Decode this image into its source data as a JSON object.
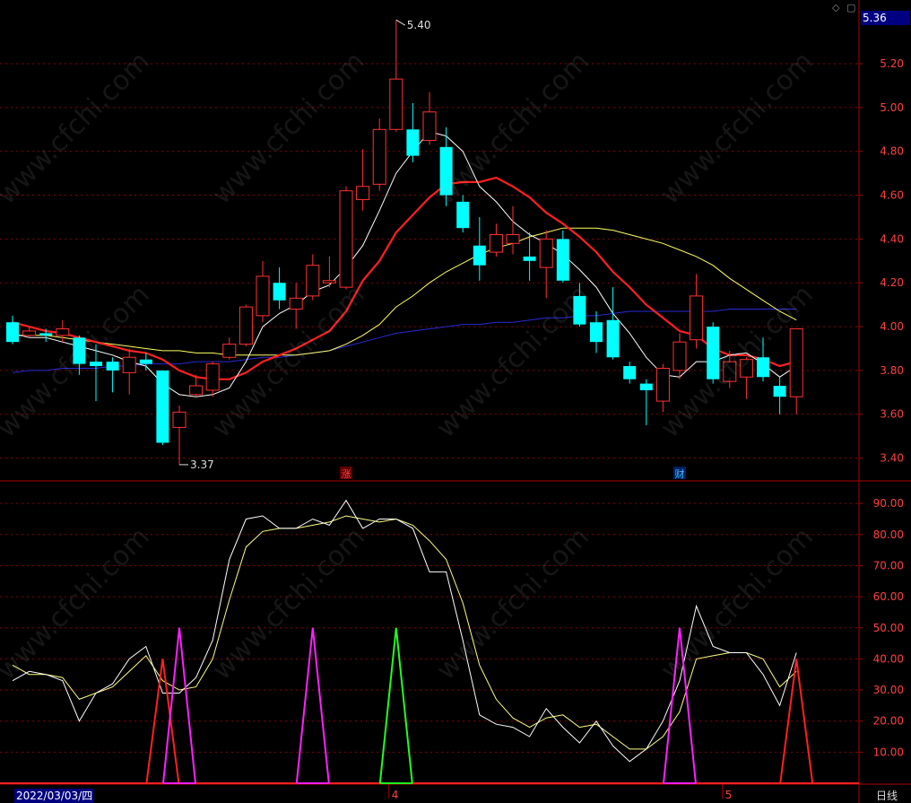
{
  "header": {
    "current_price": "5.36",
    "diamond_icon": "diamond-icon",
    "close_icon": "close-icon"
  },
  "footer": {
    "date": "2022/03/03/四",
    "period": "日线"
  },
  "watermark": "www.cfchi.com",
  "colors": {
    "up": "#ff3232",
    "down": "#00ffff",
    "ma5": "#ffffff",
    "ma10": "#ff2020",
    "ma20": "#ffff60",
    "ma60": "#2a2ad8",
    "grid": "#8b0000",
    "axis_text": "#ff4040"
  },
  "chart_data": [
    {
      "type": "candlestick",
      "ylim": [
        3.3,
        5.45
      ],
      "y_ticks": [
        "5.20",
        "5.00",
        "4.80",
        "4.60",
        "4.40",
        "4.20",
        "4.00",
        "3.80",
        "3.60",
        "3.40"
      ],
      "annotations": {
        "high": "5.40",
        "low": "3.37",
        "markers": [
          "涨",
          "财"
        ]
      },
      "candles": [
        [
          4.02,
          3.93,
          4.05,
          3.92
        ],
        [
          3.96,
          3.98,
          4.0,
          3.95
        ],
        [
          3.97,
          3.96,
          3.99,
          3.93
        ],
        [
          3.96,
          3.99,
          4.03,
          3.93
        ],
        [
          3.95,
          3.83,
          3.96,
          3.78
        ],
        [
          3.84,
          3.82,
          3.92,
          3.66
        ],
        [
          3.84,
          3.8,
          3.86,
          3.7
        ],
        [
          3.79,
          3.86,
          3.9,
          3.69
        ],
        [
          3.85,
          3.83,
          3.88,
          3.8
        ],
        [
          3.8,
          3.47,
          3.8,
          3.46
        ],
        [
          3.54,
          3.61,
          3.64,
          3.37
        ],
        [
          3.69,
          3.73,
          3.78,
          3.68
        ],
        [
          3.71,
          3.83,
          3.84,
          3.68
        ],
        [
          3.86,
          3.92,
          3.95,
          3.85
        ],
        [
          3.92,
          4.09,
          4.1,
          3.91
        ],
        [
          4.05,
          4.23,
          4.3,
          4.02
        ],
        [
          4.2,
          4.12,
          4.27,
          4.08
        ],
        [
          4.08,
          4.13,
          4.2,
          3.99
        ],
        [
          4.14,
          4.28,
          4.33,
          4.12
        ],
        [
          4.2,
          4.21,
          4.32,
          4.18
        ],
        [
          4.18,
          4.62,
          4.64,
          4.17
        ],
        [
          4.58,
          4.64,
          4.81,
          4.53
        ],
        [
          4.65,
          4.9,
          4.95,
          4.62
        ],
        [
          4.9,
          5.13,
          5.4,
          4.89
        ],
        [
          4.9,
          4.78,
          5.02,
          4.75
        ],
        [
          4.85,
          4.98,
          5.07,
          4.83
        ],
        [
          4.82,
          4.6,
          4.91,
          4.55
        ],
        [
          4.57,
          4.45,
          4.6,
          4.43
        ],
        [
          4.37,
          4.28,
          4.5,
          4.21
        ],
        [
          4.34,
          4.42,
          4.47,
          4.32
        ],
        [
          4.38,
          4.42,
          4.55,
          4.33
        ],
        [
          4.32,
          4.3,
          4.43,
          4.21
        ],
        [
          4.27,
          4.4,
          4.44,
          4.13
        ],
        [
          4.4,
          4.21,
          4.44,
          4.2
        ],
        [
          4.14,
          4.01,
          4.2,
          4.0
        ],
        [
          4.02,
          3.93,
          4.07,
          3.88
        ],
        [
          4.03,
          3.86,
          4.18,
          3.85
        ],
        [
          3.82,
          3.76,
          3.84,
          3.74
        ],
        [
          3.74,
          3.71,
          3.76,
          3.55
        ],
        [
          3.66,
          3.81,
          3.83,
          3.61
        ],
        [
          3.8,
          3.93,
          3.97,
          3.76
        ],
        [
          3.94,
          4.14,
          4.24,
          3.9
        ],
        [
          4.0,
          3.76,
          4.02,
          3.74
        ],
        [
          3.75,
          3.84,
          3.89,
          3.72
        ],
        [
          3.77,
          3.85,
          3.86,
          3.67
        ],
        [
          3.86,
          3.77,
          3.95,
          3.75
        ],
        [
          3.73,
          3.68,
          3.77,
          3.6
        ],
        [
          3.68,
          3.99,
          3.99,
          3.6
        ]
      ],
      "ma5": [
        3.97,
        3.95,
        3.95,
        3.93,
        3.91,
        3.89,
        3.87,
        3.84,
        3.82,
        3.74,
        3.69,
        3.68,
        3.69,
        3.72,
        3.84,
        4.0,
        4.06,
        4.1,
        4.16,
        4.19,
        4.27,
        4.37,
        4.53,
        4.7,
        4.8,
        4.89,
        4.87,
        4.8,
        4.64,
        4.57,
        4.48,
        4.42,
        4.38,
        4.33,
        4.26,
        4.18,
        4.06,
        3.97,
        3.86,
        3.78,
        3.77,
        3.84,
        3.84,
        3.87,
        3.88,
        3.83,
        3.77,
        3.82
      ],
      "ma10": [
        4.02,
        4.0,
        3.98,
        3.97,
        3.95,
        3.93,
        3.91,
        3.89,
        3.88,
        3.85,
        3.8,
        3.77,
        3.76,
        3.76,
        3.79,
        3.84,
        3.87,
        3.9,
        3.94,
        3.98,
        4.07,
        4.21,
        4.3,
        4.43,
        4.51,
        4.59,
        4.65,
        4.66,
        4.66,
        4.68,
        4.64,
        4.59,
        4.52,
        4.47,
        4.41,
        4.34,
        4.25,
        4.18,
        4.1,
        4.04,
        3.98,
        3.96,
        3.9,
        3.87,
        3.87,
        3.85,
        3.82,
        3.84
      ],
      "ma20": [
        3.96,
        3.96,
        3.96,
        3.95,
        3.94,
        3.93,
        3.92,
        3.91,
        3.9,
        3.89,
        3.89,
        3.88,
        3.88,
        3.87,
        3.87,
        3.87,
        3.87,
        3.87,
        3.88,
        3.89,
        3.92,
        3.96,
        4.01,
        4.09,
        4.14,
        4.2,
        4.25,
        4.29,
        4.33,
        4.36,
        4.38,
        4.41,
        4.43,
        4.45,
        4.45,
        4.45,
        4.44,
        4.42,
        4.4,
        4.38,
        4.35,
        4.32,
        4.28,
        4.22,
        4.17,
        4.12,
        4.07,
        4.03
      ],
      "ma60": [
        3.79,
        3.8,
        3.8,
        3.81,
        3.81,
        3.81,
        3.82,
        3.82,
        3.83,
        3.83,
        3.83,
        3.84,
        3.84,
        3.84,
        3.85,
        3.86,
        3.86,
        3.87,
        3.88,
        3.89,
        3.91,
        3.93,
        3.95,
        3.97,
        3.98,
        3.99,
        4.0,
        4.01,
        4.01,
        4.02,
        4.02,
        4.03,
        4.04,
        4.04,
        4.05,
        4.05,
        4.06,
        4.07,
        4.07,
        4.07,
        4.07,
        4.07,
        4.07,
        4.08,
        4.08,
        4.08,
        4.08,
        4.08
      ]
    },
    {
      "type": "line",
      "ylim": [
        0,
        100
      ],
      "y_ticks": [
        "90.00",
        "80.00",
        "70.00",
        "60.00",
        "50.00",
        "40.00",
        "30.00",
        "20.00",
        "10.00"
      ],
      "x_ticks": [
        {
          "label": "4",
          "index": 23
        },
        {
          "label": "5",
          "index": 43
        }
      ],
      "series": [
        {
          "values": [
            33,
            36,
            35,
            33,
            20,
            29,
            32,
            40,
            44,
            29,
            29,
            34,
            46,
            72,
            85,
            86,
            82,
            82,
            85,
            83,
            91,
            82,
            85,
            85,
            82,
            68,
            68,
            46,
            22,
            19,
            18,
            15,
            24,
            18,
            13,
            20,
            12,
            7,
            11,
            20,
            33,
            57,
            44,
            42,
            42,
            35,
            25,
            42
          ]
        },
        {
          "values": [
            38,
            35,
            35,
            34,
            27,
            29,
            31,
            36,
            41,
            33,
            30,
            31,
            40,
            59,
            76,
            81,
            82,
            82,
            83,
            84,
            86,
            85,
            84,
            85,
            83,
            78,
            72,
            58,
            38,
            27,
            21,
            18,
            21,
            22,
            18,
            19,
            15,
            11,
            11,
            15,
            23,
            40,
            41,
            42,
            42,
            40,
            31,
            36
          ]
        }
      ],
      "signals": [
        {
          "color": "#ff2020",
          "peak": 40,
          "index": 9
        },
        {
          "color": "#ff20ff",
          "peak": 50,
          "index": 10
        },
        {
          "color": "#ff20ff",
          "peak": 50,
          "index": 18
        },
        {
          "color": "#20ff20",
          "peak": 50,
          "index": 23
        },
        {
          "color": "#ff20ff",
          "peak": 50,
          "index": 40
        },
        {
          "color": "#ff2020",
          "peak": 40,
          "index": 47
        }
      ]
    }
  ]
}
